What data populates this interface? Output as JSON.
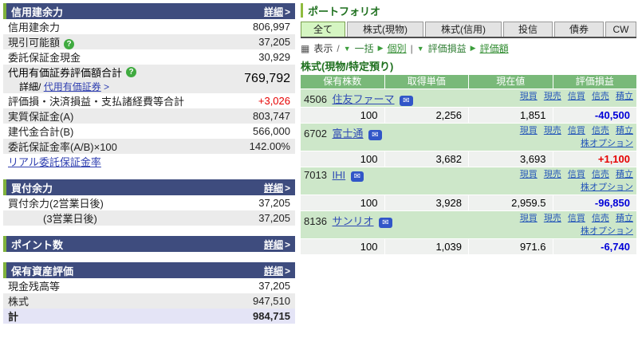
{
  "icons": {
    "help": "?",
    "mail": "✉",
    "grid": "▦",
    "tri_down": "▼",
    "tri_right": "▶",
    "arrow": ">"
  },
  "colors": {
    "header_navy": "#3e4c7e",
    "accent_green": "#7fb23c",
    "title_green": "#1e701e",
    "table_header_green": "#79b979",
    "name_row_green": "#cde7c9",
    "profit_red": "#e60000",
    "loss_blue": "#0000d8",
    "link_blue": "#2f4bb5",
    "selected_tab_green": "#d5f5c2",
    "total_row_lavender": "#e4e4f6"
  },
  "left": {
    "margin_power": {
      "title": "信用建余力",
      "detail": "詳細",
      "rows": {
        "shinyo": {
          "label": "信用建余力",
          "value": "806,997"
        },
        "genbiki": {
          "label": "現引可能額",
          "value": "37,205"
        },
        "itaku_cash": {
          "label": "委託保証金現金",
          "value": "30,929"
        },
        "daiyo": {
          "label": "代用有価証券評価額合計",
          "value": "769,792",
          "sub_prefix": "詳細/",
          "sub_link": "代用有価証券"
        },
        "hyoka": {
          "label": "評価損・決済損益・支払諸経費等合計",
          "value": "+3,026"
        },
        "jisshitsu": {
          "label": "実質保証金(A)",
          "value": "803,747"
        },
        "tatedai": {
          "label": "建代金合計(B)",
          "value": "566,000"
        },
        "ritsu": {
          "label": "委託保証金率(A/B)×100",
          "value": "142.00%"
        },
        "real_link": "リアル委託保証金率"
      }
    },
    "buying_power": {
      "title": "買付余力",
      "detail": "詳細",
      "rows": [
        {
          "label": "買付余力(2営業日後)",
          "value": "37,205"
        },
        {
          "label": "(3営業日後)",
          "value": "37,205"
        }
      ]
    },
    "points": {
      "title": "ポイント数",
      "detail": "詳細"
    },
    "assets": {
      "title": "保有資産評価",
      "detail": "詳細",
      "rows": [
        {
          "label": "現金残高等",
          "value": "37,205"
        },
        {
          "label": "株式",
          "value": "947,510"
        },
        {
          "label": "計",
          "value": "984,715"
        }
      ]
    }
  },
  "portfolio": {
    "title": "ポートフォリオ",
    "tabs": [
      {
        "label": "全て",
        "selected": true
      },
      {
        "label": "株式(現物)",
        "selected": false
      },
      {
        "label": "株式(信用)",
        "selected": false
      },
      {
        "label": "投信",
        "selected": false
      },
      {
        "label": "債券",
        "selected": false
      },
      {
        "label": "CW",
        "selected": false
      }
    ],
    "toolbar": {
      "display": "表示",
      "sep1": "/",
      "batch": "一括",
      "individual": "個別",
      "sep2": "|",
      "pl": "評価損益",
      "valuation": "評価額"
    },
    "section_title": "株式(現物/特定預り)",
    "table": {
      "headers": [
        "保有株数",
        "取得単価",
        "現在値",
        "評価損益"
      ],
      "actions": [
        "現買",
        "現売",
        "信買",
        "信売",
        "積立"
      ],
      "option_action": "株オプション",
      "stocks": [
        {
          "code": "4506",
          "name": "住友ファーマ",
          "qty": "100",
          "cost": "2,256",
          "price": "1,851",
          "pl": "-40,500",
          "has_option": false
        },
        {
          "code": "6702",
          "name": "富士通",
          "qty": "100",
          "cost": "3,682",
          "price": "3,693",
          "pl": "+1,100",
          "has_option": true
        },
        {
          "code": "7013",
          "name": "IHI",
          "qty": "100",
          "cost": "3,928",
          "price": "2,959.5",
          "pl": "-96,850",
          "has_option": true
        },
        {
          "code": "8136",
          "name": "サンリオ",
          "qty": "100",
          "cost": "1,039",
          "price": "971.6",
          "pl": "-6,740",
          "has_option": true
        }
      ]
    }
  }
}
